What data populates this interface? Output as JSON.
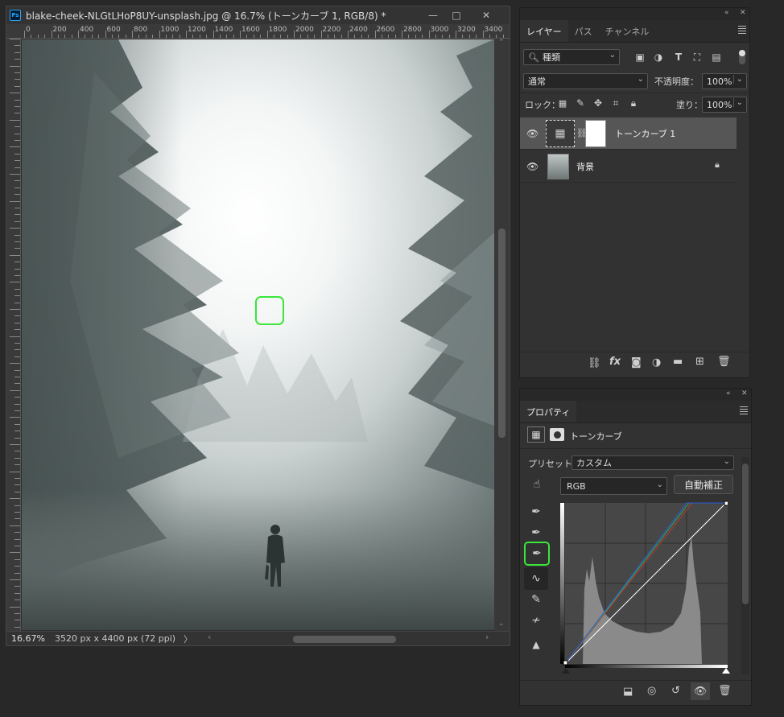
{
  "document": {
    "app_icon": "Ps",
    "title": "blake-cheek-NLGtLHoP8UY-unsplash.jpg @ 16.7% (トーンカーブ 1, RGB/8) *",
    "window_buttons": {
      "minimize": "—",
      "restore": "□",
      "close": "✕"
    },
    "ruler_h_labels": [
      "0",
      "200",
      "400",
      "600",
      "800",
      "1000",
      "1200",
      "1400",
      "1600",
      "1800",
      "2000",
      "2200",
      "2400",
      "2600",
      "2800",
      "3000",
      "3200",
      "3400"
    ],
    "zoom": "16.67%",
    "doc_size": "3520 px x 4400 px (72 ppi)",
    "status_arrow": "〉",
    "scroll_left": "‹",
    "scroll_right": "›",
    "scroll_down": "⌄",
    "scroll_up": "⌃"
  },
  "layers_panel": {
    "collapse": "«",
    "close": "✕",
    "tabs": [
      "レイヤー",
      "パス",
      "チャンネル"
    ],
    "filter_kind": "種類",
    "blend_mode": "通常",
    "opacity_label": "不透明度：",
    "opacity_value": "100%",
    "lock_label": "ロック：",
    "fill_label": "塗り：",
    "fill_value": "100%",
    "layers": [
      {
        "name": "トーンカーブ 1",
        "visible": true,
        "selected": true
      },
      {
        "name": "背景",
        "visible": true,
        "selected": false,
        "locked": true
      }
    ],
    "footer_icons": [
      "link-icon",
      "fx-icon",
      "mask-icon",
      "adjustment-icon",
      "folder-icon",
      "new-layer-icon",
      "trash-icon"
    ]
  },
  "properties_panel": {
    "collapse": "«",
    "close": "✕",
    "tab": "プロパティ",
    "header_label": "トーンカーブ",
    "preset_label": "プリセット：",
    "preset_value": "カスタム",
    "channel_value": "RGB",
    "auto_button": "自動補正",
    "tools": [
      "target-adjust-icon",
      "black-point-eyedropper-icon",
      "gray-point-eyedropper-icon",
      "white-point-eyedropper-icon",
      "curve-edit-icon",
      "pencil-icon",
      "smooth-icon",
      "clipping-warning-icon"
    ],
    "footer_icons": [
      "clip-to-layer-icon",
      "view-previous-icon",
      "reset-icon",
      "visibility-icon",
      "trash-icon"
    ],
    "colors": {
      "red_curve": "#c0392b",
      "green_curve": "#27ae60",
      "blue_curve": "#2c5fd6",
      "rgb_curve": "#ffffff",
      "highlight": "#39e639"
    }
  }
}
